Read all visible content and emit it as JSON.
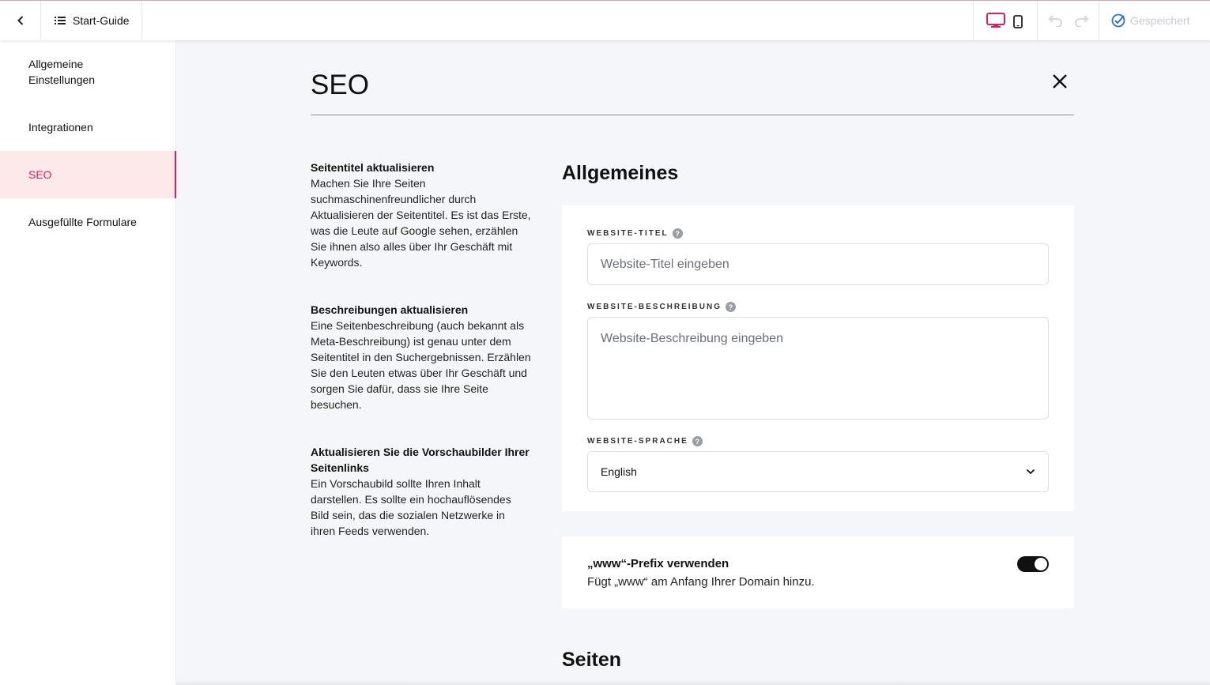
{
  "topbar": {
    "back_icon": "chevron-left-icon",
    "guide_label": "Start-Guide",
    "guide_icon": "list-icon",
    "device_desktop_icon": "desktop-icon",
    "device_mobile_icon": "mobile-icon",
    "undo_icon": "undo-icon",
    "redo_icon": "redo-icon",
    "saved_label": "Gespeichert",
    "saved_icon": "check-circle-icon",
    "accent_color": "#e01e5a",
    "saved_color": "#2f6fe4"
  },
  "sidebar": {
    "items": [
      {
        "label": "Allgemeine Einstellungen",
        "active": false
      },
      {
        "label": "Integrationen",
        "active": false
      },
      {
        "label": "SEO",
        "active": true
      },
      {
        "label": "Ausgefüllte Formulare",
        "active": false
      }
    ]
  },
  "main": {
    "title": "SEO",
    "close_icon": "close-icon",
    "help": [
      {
        "heading": "Seitentitel aktualisieren",
        "text": "Machen Sie Ihre Seiten suchmaschinenfreundlicher durch Aktualisieren der Seitentitel. Es ist das Erste, was die Leute auf Google sehen, erzählen Sie ihnen also alles über Ihr Geschäft mit Keywords."
      },
      {
        "heading": "Beschreibungen aktualisieren",
        "text": "Eine Seitenbeschreibung (auch bekannt als Meta-Beschreibung) ist genau unter dem Seitentitel in den Suchergebnissen. Erzählen Sie den Leuten etwas über Ihr Geschäft und sorgen Sie dafür, dass sie Ihre Seite besuchen."
      },
      {
        "heading": "Aktualisieren Sie die Vorschaubilder Ihrer Seitenlinks",
        "text": "Ein Vorschaubild sollte Ihren Inhalt darstellen. Es sollte ein hochauflösendes Bild sein, das die sozialen Netzwerke in ihren Feeds verwenden."
      }
    ],
    "general": {
      "heading": "Allgemeines",
      "site_title": {
        "label": "WEBSITE-TITEL",
        "placeholder": "Website-Titel eingeben",
        "value": ""
      },
      "site_description": {
        "label": "WEBSITE-BESCHREIBUNG",
        "placeholder": "Website-Beschreibung eingeben",
        "value": ""
      },
      "site_language": {
        "label": "WEBSITE-SPRACHE",
        "value": "English",
        "icon": "chevron-down-icon"
      },
      "help_icon": "question-mark-icon",
      "help_glyph": "?"
    },
    "www": {
      "title": "„www“-Prefix verwenden",
      "description": "Fügt „www“ am Anfang Ihrer Domain hinzu.",
      "enabled": true
    },
    "pages_heading": "Seiten"
  }
}
